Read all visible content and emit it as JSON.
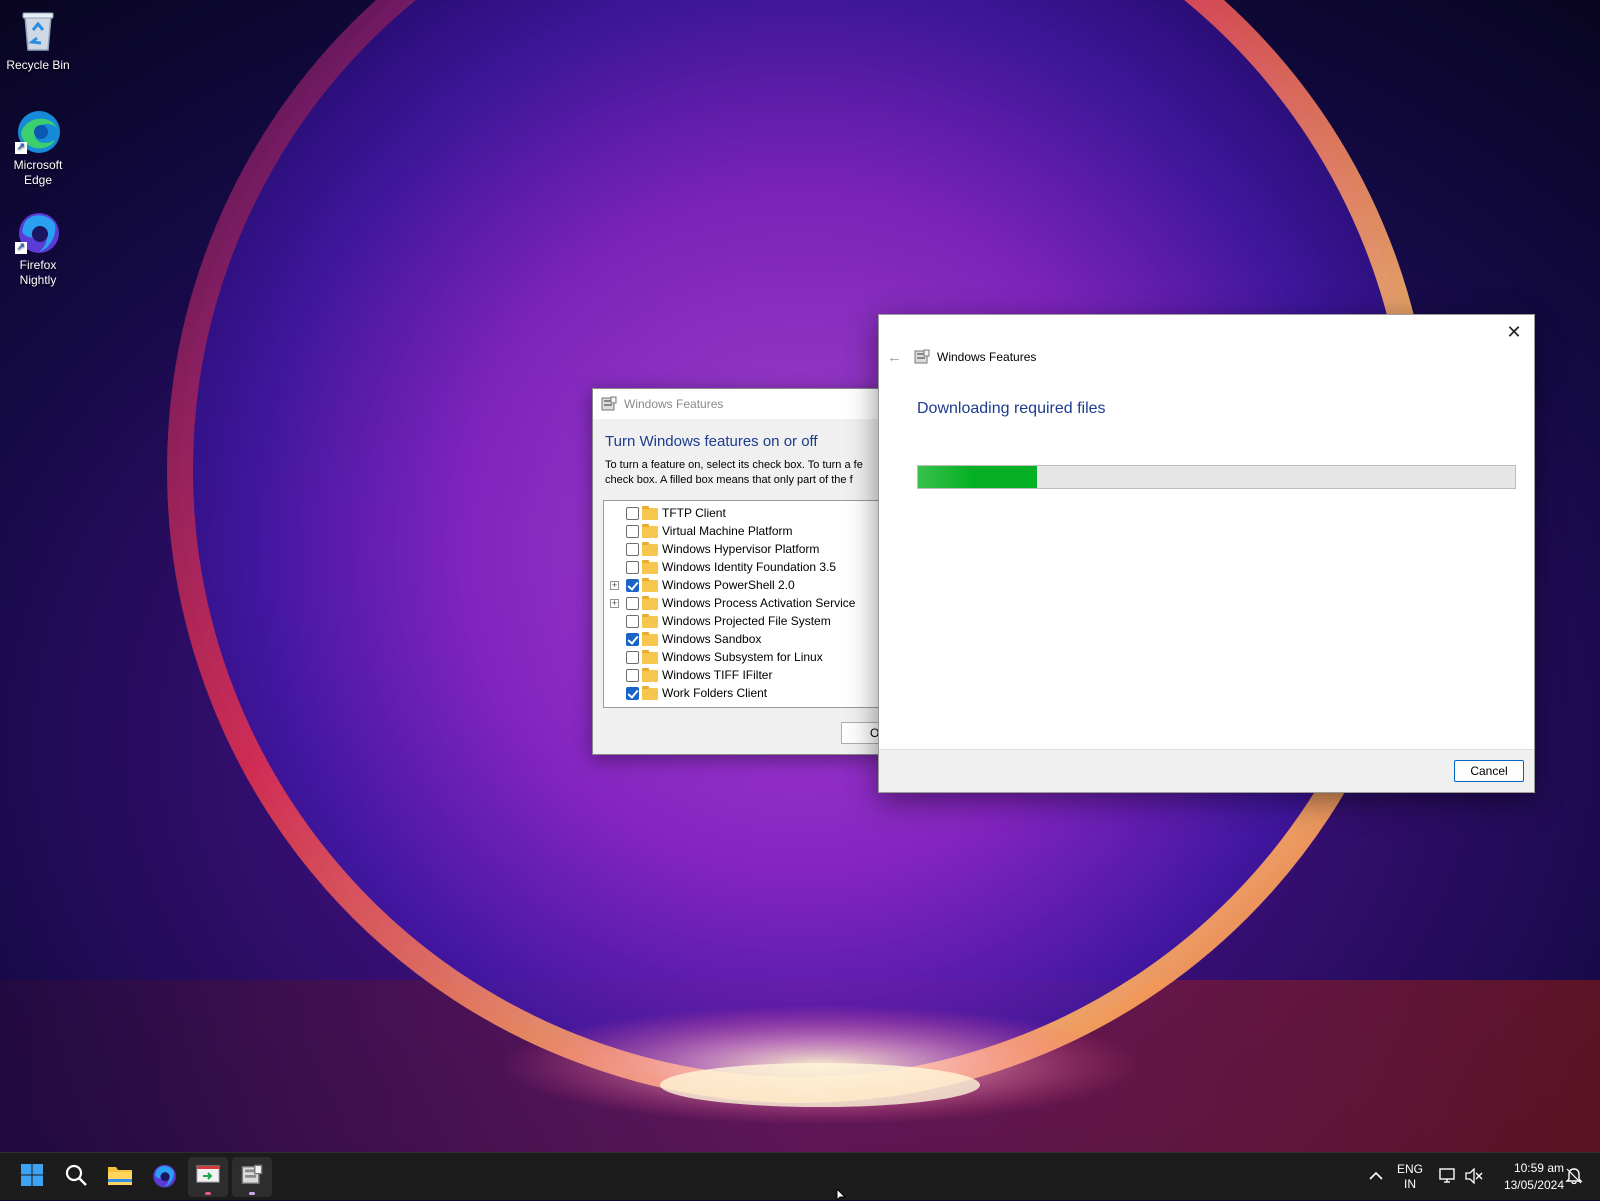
{
  "desktop": {
    "icons": [
      {
        "label": "Recycle Bin"
      },
      {
        "label": "Microsoft Edge"
      },
      {
        "label": "Firefox Nightly"
      }
    ]
  },
  "legacy_window": {
    "title": "Windows Features",
    "heading": "Turn Windows features on or off",
    "description_line1": "To turn a feature on, select its check box. To turn a fe",
    "description_line2": "check box. A filled box means that only part of the f",
    "ok_label": "OK",
    "features": [
      {
        "label": "TFTP Client",
        "checked": false,
        "expandable": false
      },
      {
        "label": "Virtual Machine Platform",
        "checked": false,
        "expandable": false
      },
      {
        "label": "Windows Hypervisor Platform",
        "checked": false,
        "expandable": false
      },
      {
        "label": "Windows Identity Foundation 3.5",
        "checked": false,
        "expandable": false
      },
      {
        "label": "Windows PowerShell 2.0",
        "checked": true,
        "expandable": true
      },
      {
        "label": "Windows Process Activation Service",
        "checked": false,
        "expandable": true
      },
      {
        "label": "Windows Projected File System",
        "checked": false,
        "expandable": false
      },
      {
        "label": "Windows Sandbox",
        "checked": true,
        "expandable": false
      },
      {
        "label": "Windows Subsystem for Linux",
        "checked": false,
        "expandable": false
      },
      {
        "label": "Windows TIFF IFilter",
        "checked": false,
        "expandable": false
      },
      {
        "label": "Work Folders Client",
        "checked": true,
        "expandable": false
      }
    ]
  },
  "progress_dialog": {
    "title": "Windows Features",
    "heading": "Downloading required files",
    "progress_fraction": 0.2,
    "cancel_label": "Cancel",
    "accent_color": "#06b025"
  },
  "taskbar": {
    "apps": [
      {
        "icon": "windows-start-icon"
      },
      {
        "icon": "search-icon"
      },
      {
        "icon": "file-explorer-icon"
      },
      {
        "icon": "firefox-nightly-icon"
      },
      {
        "icon": "remote-desktop-icon"
      },
      {
        "icon": "windows-features-icon"
      }
    ],
    "tray": {
      "language_line1": "ENG",
      "language_line2": "IN",
      "time": "10:59 am",
      "date": "13/05/2024"
    }
  }
}
